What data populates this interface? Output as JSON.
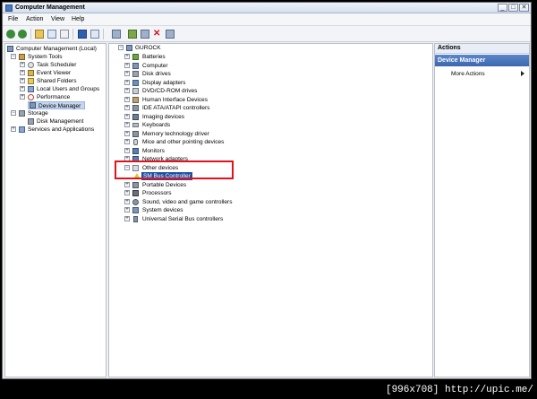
{
  "window": {
    "title": "Computer Management"
  },
  "menu": [
    "File",
    "Action",
    "View",
    "Help"
  ],
  "left_tree": {
    "root": "Computer Management (Local)",
    "system_tools": "System Tools",
    "task_scheduler": "Task Scheduler",
    "event_viewer": "Event Viewer",
    "shared_folders": "Shared Folders",
    "local_users": "Local Users and Groups",
    "performance": "Performance",
    "device_manager": "Device Manager",
    "storage": "Storage",
    "disk_management": "Disk Management",
    "services": "Services and Applications"
  },
  "device_tree": {
    "computer": "GUROCK",
    "categories": [
      "Batteries",
      "Computer",
      "Disk drives",
      "Display adapters",
      "DVD/CD-ROM drives",
      "Human Interface Devices",
      "IDE ATA/ATAPI controllers",
      "Imaging devices",
      "Keyboards",
      "Memory technology driver",
      "Mice and other pointing devices",
      "Monitors",
      "Network adapters",
      "Other devices",
      "SM Bus Controller",
      "Portable Devices",
      "Processors",
      "Sound, video and game controllers",
      "System devices",
      "Universal Serial Bus controllers"
    ]
  },
  "actions": {
    "header": "Actions",
    "selected": "Device Manager",
    "more_actions": "More Actions"
  },
  "watermark": "[996x708] http://upic.me/",
  "colors": {
    "highlight_box": "#e0121d",
    "selection": "#1f4fa3",
    "actions_selected": "#3c68b0"
  }
}
